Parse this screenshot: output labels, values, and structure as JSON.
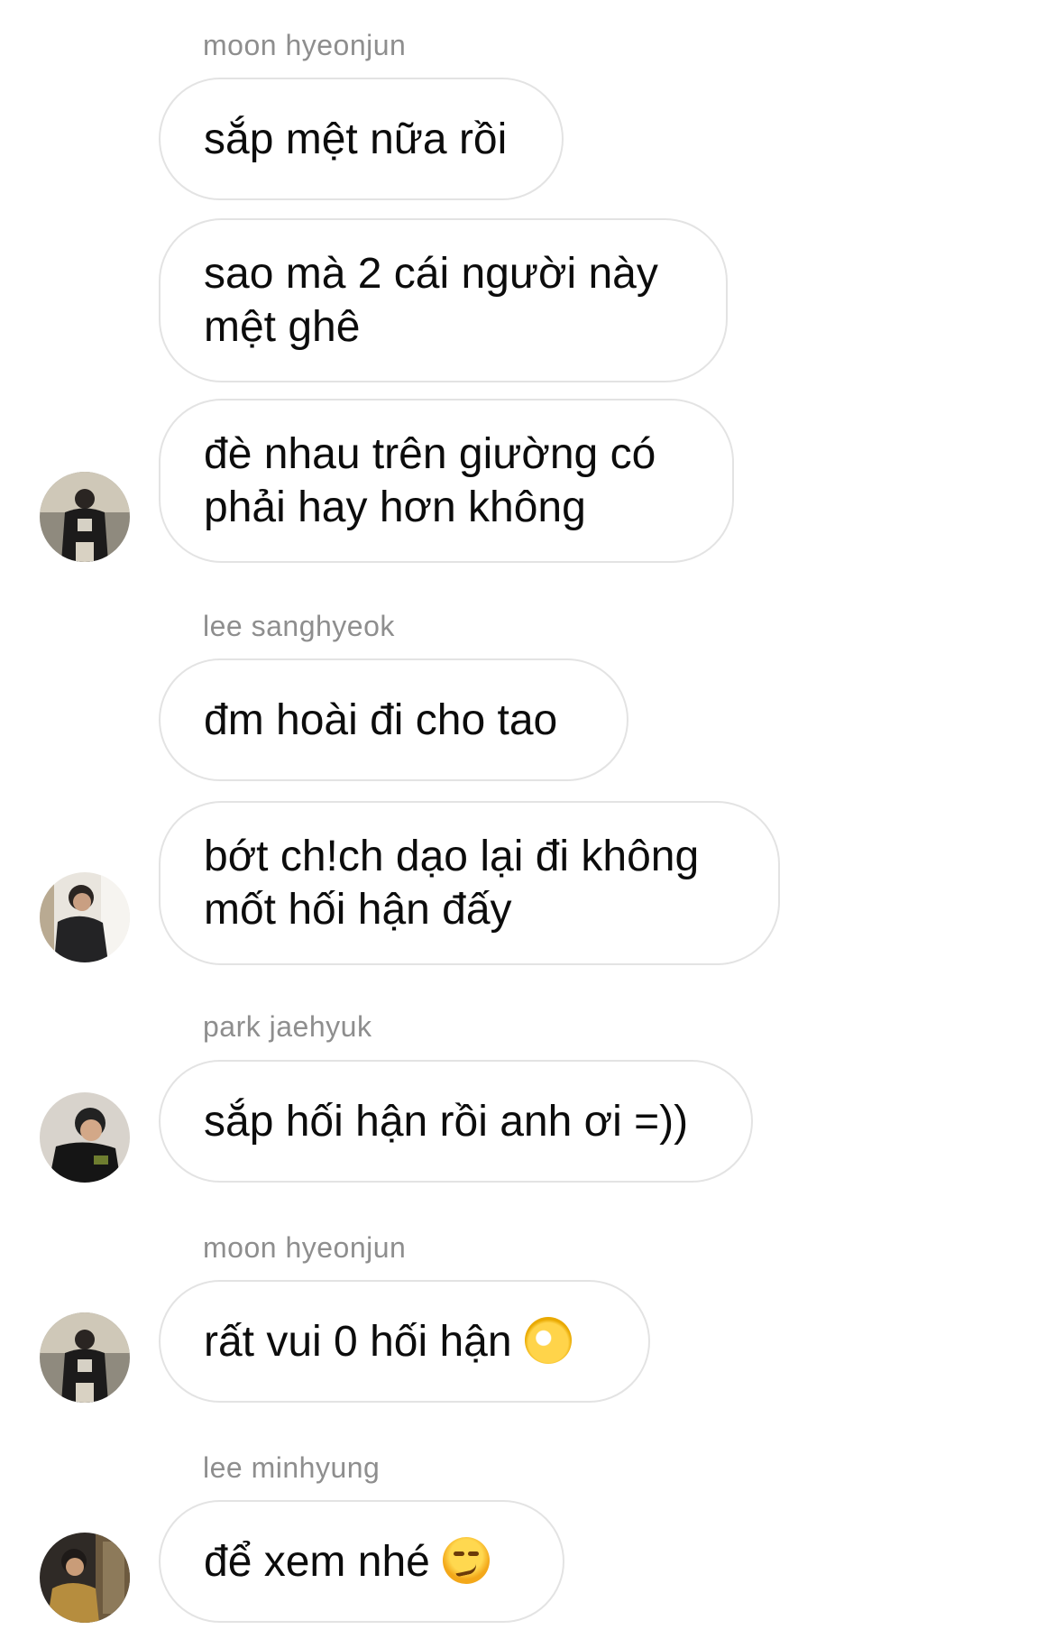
{
  "chat": {
    "groups": [
      {
        "sender": "moon hyeonjun",
        "messages": [
          "sắp mệt nữa rồi",
          "sao mà 2 cái người này\nmệt ghê",
          "đè nhau trên giường có\nphải hay hơn không"
        ],
        "avatar_icon": "user-avatar-icon"
      },
      {
        "sender": "lee sanghyeok",
        "messages": [
          "đm hoài đi cho tao",
          "bớt ch!ch dạo lại đi không\nmốt hối hận đấy"
        ],
        "avatar_icon": "user-avatar-icon"
      },
      {
        "sender": "park jaehyuk",
        "messages": [
          "sắp hối hận rồi anh ơi =))"
        ],
        "avatar_icon": "user-avatar-icon"
      },
      {
        "sender": "moon hyeonjun",
        "messages": [
          "rất vui 0 hối hận"
        ],
        "emoji": "ok-hand-emoji",
        "avatar_icon": "user-avatar-icon"
      },
      {
        "sender": "lee minhyung",
        "messages": [
          "để xem nhé"
        ],
        "emoji": "smirking-face-emoji",
        "avatar_icon": "user-avatar-icon"
      }
    ]
  },
  "colors": {
    "sender_text": "#8e8e8e",
    "bubble_border": "#e3e3e3",
    "message_text": "#0c0c0c",
    "background": "#ffffff"
  }
}
